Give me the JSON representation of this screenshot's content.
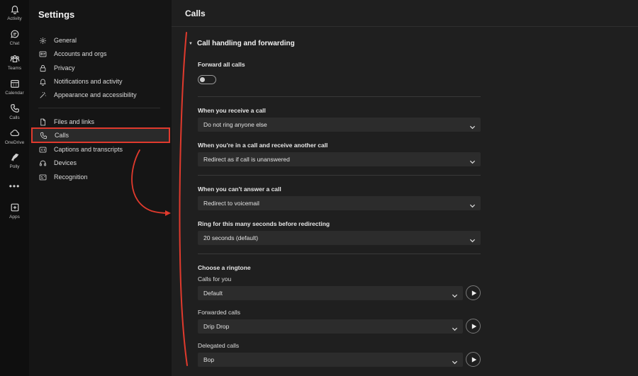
{
  "rail": {
    "items": [
      {
        "label": "Activity",
        "icon": "bell-icon"
      },
      {
        "label": "Chat",
        "icon": "chat-icon"
      },
      {
        "label": "Teams",
        "icon": "teams-icon"
      },
      {
        "label": "Calendar",
        "icon": "calendar-icon"
      },
      {
        "label": "Calls",
        "icon": "phone-icon"
      },
      {
        "label": "OneDrive",
        "icon": "cloud-icon"
      },
      {
        "label": "Polly",
        "icon": "polly-icon"
      },
      {
        "label": "Apps",
        "icon": "plus-square-icon"
      }
    ],
    "more": "•••"
  },
  "settings": {
    "title": "Settings",
    "nav": [
      {
        "label": "General",
        "icon": "gear-icon"
      },
      {
        "label": "Accounts and orgs",
        "icon": "id-card-icon"
      },
      {
        "label": "Privacy",
        "icon": "lock-icon"
      },
      {
        "label": "Notifications and activity",
        "icon": "bell-icon"
      },
      {
        "label": "Appearance and accessibility",
        "icon": "wand-icon"
      },
      {
        "label": "Files and links",
        "icon": "file-icon"
      },
      {
        "label": "Calls",
        "icon": "phone-icon",
        "active": true
      },
      {
        "label": "Captions and transcripts",
        "icon": "captions-icon"
      },
      {
        "label": "Devices",
        "icon": "headset-icon"
      },
      {
        "label": "Recognition",
        "icon": "recognition-icon"
      }
    ]
  },
  "main": {
    "title": "Calls",
    "section": {
      "title": "Call handling and forwarding",
      "forward_all_label": "Forward all calls",
      "forward_all_on": false,
      "receive_label": "When you receive a call",
      "receive_value": "Do not ring anyone else",
      "in_call_label": "When you're in a call and receive another call",
      "in_call_value": "Redirect as if call is unanswered",
      "cant_answer_label": "When you can't answer a call",
      "cant_answer_value": "Redirect to voicemail",
      "ring_label": "Ring for this many seconds before redirecting",
      "ring_value": "20 seconds (default)",
      "ringtone_label": "Choose a ringtone",
      "calls_for_you_label": "Calls for you",
      "calls_for_you_value": "Default",
      "forwarded_label": "Forwarded calls",
      "forwarded_value": "Drip Drop",
      "delegated_label": "Delegated calls",
      "delegated_value": "Bop"
    }
  },
  "colors": {
    "annotation": "#e03a2d",
    "background": "#1f1f1f",
    "sidebar": "#151515",
    "rail": "#0f0f0f"
  }
}
